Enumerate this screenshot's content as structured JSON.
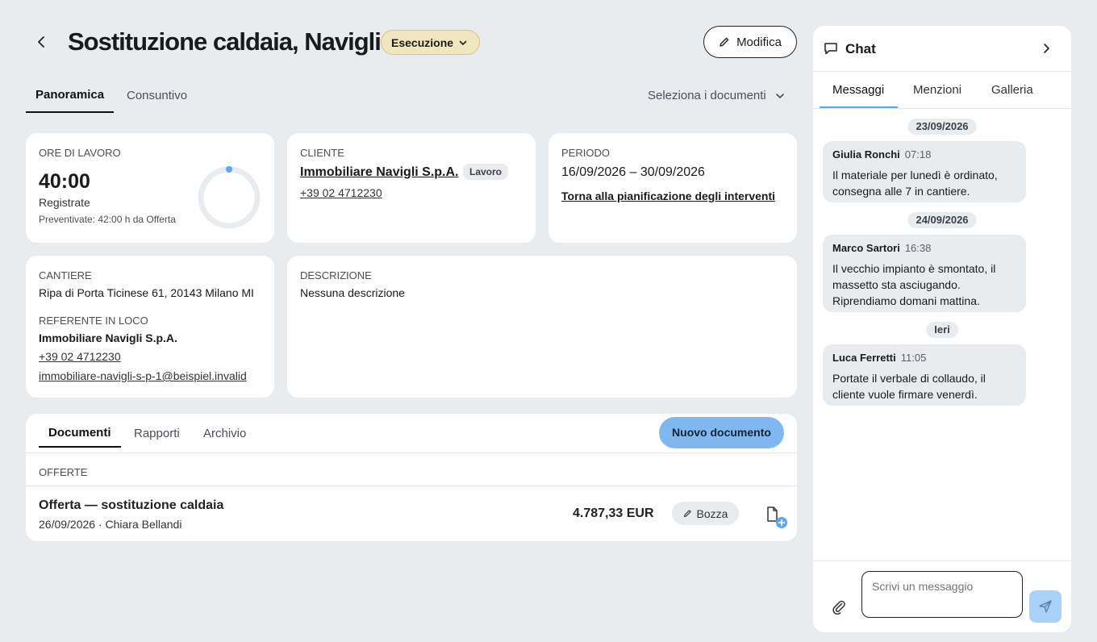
{
  "header": {
    "title": "Sostituzione caldaia, Navigli",
    "status_label": "Esecuzione",
    "edit_label": "Modifica"
  },
  "tabs": [
    "Panoramica",
    "Consuntivo"
  ],
  "document_select": {
    "label": "Seleziona i documenti"
  },
  "work_hours": {
    "section_label": "ORE DI LAVORO",
    "value": "40:00",
    "registered_label": "Registrate",
    "planned_text": "Preventivate: 42:00 h da Offerta",
    "progress_ratio": 0.0
  },
  "client": {
    "section_label": "CLIENTE",
    "name": "Immobiliare Navigli S.p.A.",
    "badge": "Lavoro",
    "phone": "+39 02 4712230"
  },
  "period": {
    "section_label": "PERIODO",
    "range": "16/09/2026 – 30/09/2026",
    "link": "Torna alla pianificazione degli interventi"
  },
  "site": {
    "section_label": "CANTIERE",
    "address": "Ripa di Porta Ticinese 61, 20143 Milano MI",
    "contact_label": "REFERENTE IN LOCO",
    "contact_name": "Immobiliare Navigli S.p.A.",
    "contact_phone": "+39 02 4712230",
    "contact_email": "immobiliare-navigli-s-p-1@beispiel.invalid"
  },
  "description": {
    "section_label": "DESCRIZIONE",
    "text": "Nessuna descrizione"
  },
  "documents": {
    "tabs": [
      "Documenti",
      "Rapporti",
      "Archivio"
    ],
    "new_button": "Nuovo documento",
    "group_label": "OFFERTE",
    "items": [
      {
        "title": "Offerta — sostituzione caldaia",
        "meta": "26/09/2026 · Chiara Bellandi",
        "amount": "4.787,33 EUR",
        "status": "Bozza"
      }
    ]
  },
  "chat": {
    "title": "Chat",
    "tabs": [
      "Messaggi",
      "Menzioni",
      "Galleria"
    ],
    "messages": [
      {
        "date": "23/09/2026",
        "author": "Giulia Ronchi",
        "time": "07:18",
        "text": "Il materiale per lunedì è ordinato, consegna alle 7 in cantiere."
      },
      {
        "date": "24/09/2026",
        "author": "Marco Sartori",
        "time": "16:38",
        "text": "Il vecchio impianto è smontato, il massetto sta asciugando. Riprendiamo domani mattina."
      },
      {
        "date": "Ieri",
        "author": "Luca Ferretti",
        "time": "11:05",
        "text": "Portate il verbale di collaudo, il cliente vuole firmare venerdì."
      }
    ],
    "input_placeholder": "Scrivi un messaggio"
  },
  "colors": {
    "accent": "#7fb8f0",
    "status_bg": "#f1e6bf",
    "status_border": "#d9c488",
    "page_bg": "#e9ecef"
  }
}
